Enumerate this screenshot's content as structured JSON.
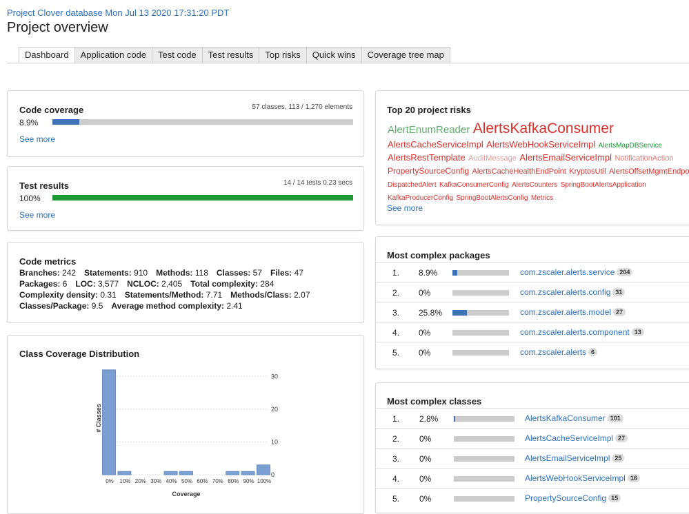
{
  "header": {
    "database_line": "Project Clover database Mon Jul 13 2020 17:31:20 PDT",
    "title": "Project overview"
  },
  "tabs": [
    {
      "label": "Dashboard",
      "active": true
    },
    {
      "label": "Application code",
      "active": false
    },
    {
      "label": "Test code",
      "active": false
    },
    {
      "label": "Test results",
      "active": false
    },
    {
      "label": "Top risks",
      "active": false
    },
    {
      "label": "Quick wins",
      "active": false
    },
    {
      "label": "Coverage tree map",
      "active": false
    }
  ],
  "code_coverage": {
    "title": "Code coverage",
    "summary": "57 classes, 113 / 1,270 elements",
    "percent_label": "8.9%",
    "percent": 8.9,
    "link": "See more",
    "color": "#3f72b5"
  },
  "test_results": {
    "title": "Test results",
    "summary": "14 / 14 tests 0.23 secs",
    "percent_label": "100%",
    "percent": 100,
    "link": "See more",
    "color": "#1a9a35"
  },
  "code_metrics": {
    "title": "Code metrics",
    "lines": [
      [
        [
          "Branches:",
          "242"
        ],
        [
          "Statements:",
          "910"
        ],
        [
          "Methods:",
          "118"
        ],
        [
          "Classes:",
          "57"
        ],
        [
          "Files:",
          "47"
        ]
      ],
      [
        [
          "Packages:",
          "6"
        ],
        [
          "LOC:",
          "3,577"
        ],
        [
          "NCLOC:",
          "2,405"
        ],
        [
          "Total complexity:",
          "284"
        ]
      ],
      [
        [
          "Complexity density:",
          "0.31"
        ],
        [
          "Statements/Method:",
          "7.71"
        ],
        [
          "Methods/Class:",
          "2.07"
        ]
      ],
      [
        [
          "Classes/Package:",
          "9.5"
        ],
        [
          "Average method complexity:",
          "2.41"
        ]
      ]
    ]
  },
  "top_risks": {
    "title": "Top 20 project risks",
    "link": "See more",
    "lines": [
      [
        {
          "text": "AlertEnumReader",
          "size": 15,
          "color": "#5fae6e"
        },
        {
          "text": "AlertsKafkaConsumer",
          "size": 21,
          "color": "#d8302b"
        }
      ],
      [
        {
          "text": "AlertsCacheServiceImpl",
          "size": 13,
          "color": "#d8302b"
        },
        {
          "text": "AlertsWebHookServiceImpl",
          "size": 13,
          "color": "#d8302b"
        },
        {
          "text": "AlertsMapDBService",
          "size": 10,
          "color": "#1a9a35"
        }
      ],
      [
        {
          "text": "AlertsRestTemplate",
          "size": 13,
          "color": "#d8302b"
        },
        {
          "text": "AuditMessage",
          "size": 11,
          "color": "#e99a98"
        },
        {
          "text": "AlertsEmailServiceImpl",
          "size": 13,
          "color": "#d8302b"
        },
        {
          "text": "NotificationAction",
          "size": 11,
          "color": "#e27a76"
        }
      ],
      [
        {
          "text": "PropertySourceConfig",
          "size": 12,
          "color": "#d8302b"
        },
        {
          "text": "AlertsCacheHealthEndPoint",
          "size": 11,
          "color": "#d8302b"
        },
        {
          "text": "KryptosUtil",
          "size": 11,
          "color": "#d8302b"
        },
        {
          "text": "AlertsOffsetMgmtEndpoint",
          "size": 11,
          "color": "#d8302b"
        }
      ],
      [
        {
          "text": "DispatchedAlert",
          "size": 10,
          "color": "#d8302b"
        },
        {
          "text": "KafkaConsumerConfig",
          "size": 10,
          "color": "#d8302b"
        },
        {
          "text": "AlertsCounters",
          "size": 10,
          "color": "#d8302b"
        },
        {
          "text": "SpringBootAlertsApplication",
          "size": 10,
          "color": "#d8302b"
        }
      ],
      [
        {
          "text": "KafkaProducerConfig",
          "size": 10,
          "color": "#d8302b"
        },
        {
          "text": "SpringBootAlertsConfig",
          "size": 10,
          "color": "#d8302b"
        },
        {
          "text": "Metrics",
          "size": 10,
          "color": "#d8302b"
        }
      ]
    ]
  },
  "complex_packages": {
    "title": "Most complex packages",
    "rows": [
      {
        "rank": "1.",
        "percent_label": "8.9%",
        "percent": 8.9,
        "name": "com.zscaler.alerts.service",
        "count": "204"
      },
      {
        "rank": "2.",
        "percent_label": "0%",
        "percent": 0,
        "name": "com.zscaler.alerts.config",
        "count": "31"
      },
      {
        "rank": "3.",
        "percent_label": "25.8%",
        "percent": 25.8,
        "name": "com.zscaler.alerts.model",
        "count": "27"
      },
      {
        "rank": "4.",
        "percent_label": "0%",
        "percent": 0,
        "name": "com.zscaler.alerts.component",
        "count": "13"
      },
      {
        "rank": "5.",
        "percent_label": "0%",
        "percent": 0,
        "name": "com.zscaler.alerts",
        "count": "6"
      }
    ]
  },
  "complex_classes": {
    "title": "Most complex classes",
    "rows": [
      {
        "rank": "1.",
        "percent_label": "2.8%",
        "percent": 2.8,
        "name": "AlertsKafkaConsumer",
        "count": "101"
      },
      {
        "rank": "2.",
        "percent_label": "0%",
        "percent": 0,
        "name": "AlertsCacheServiceImpl",
        "count": "27"
      },
      {
        "rank": "3.",
        "percent_label": "0%",
        "percent": 0,
        "name": "AlertsEmailServiceImpl",
        "count": "25"
      },
      {
        "rank": "4.",
        "percent_label": "0%",
        "percent": 0,
        "name": "AlertsWebHookServiceImpl",
        "count": "16"
      },
      {
        "rank": "5.",
        "percent_label": "0%",
        "percent": 0,
        "name": "PropertySourceConfig",
        "count": "15"
      }
    ]
  },
  "distribution": {
    "title": "Class Coverage Distribution"
  },
  "chart_data": {
    "type": "bar",
    "title": "",
    "xlabel": "Coverage",
    "ylabel": "# Classes",
    "categories": [
      "0%",
      "10%",
      "20%",
      "30%",
      "40%",
      "50%",
      "60%",
      "70%",
      "80%",
      "90%",
      "100%"
    ],
    "values": [
      32,
      1,
      0,
      0,
      1,
      1,
      0,
      0,
      1,
      1,
      3
    ],
    "y_ticks": [
      "0",
      "10",
      "20",
      "30"
    ],
    "ylim": [
      0,
      33
    ],
    "grid": true,
    "bar_color": "#7a9fd0"
  }
}
